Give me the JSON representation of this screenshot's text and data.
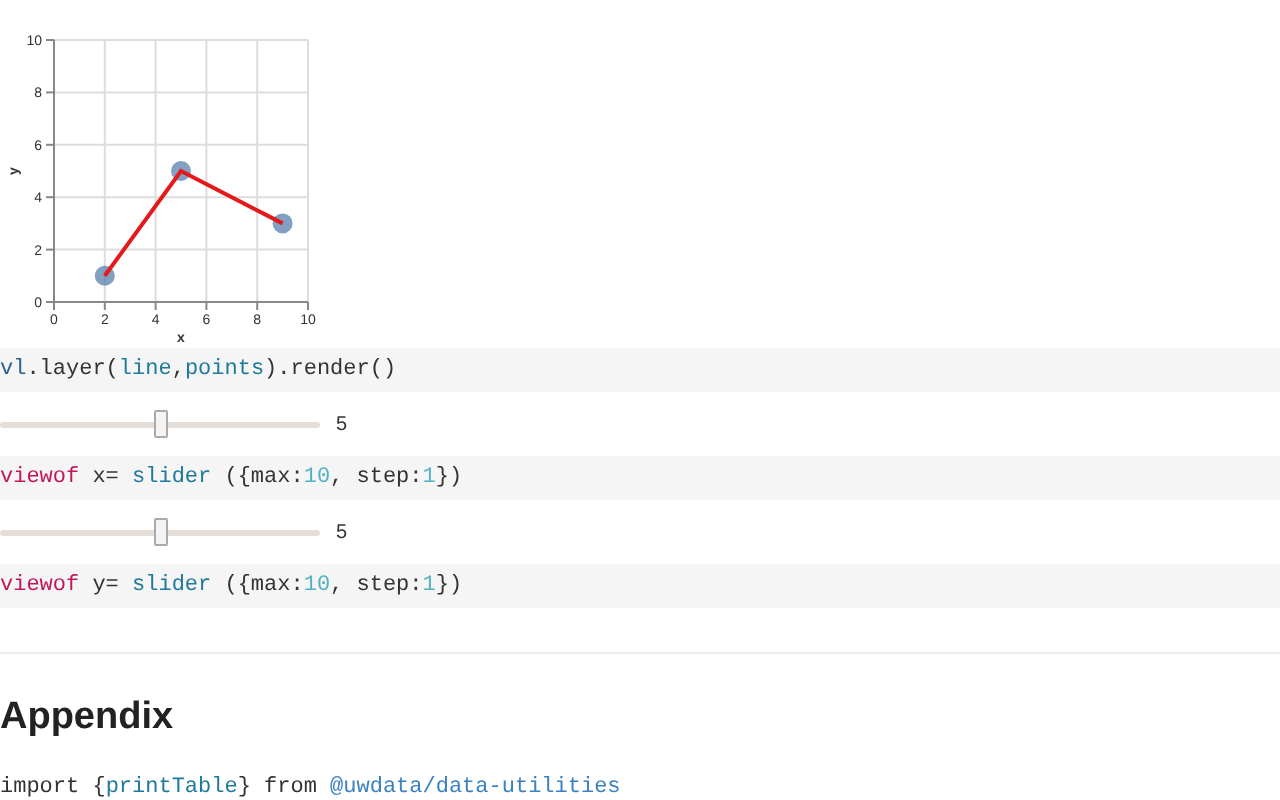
{
  "chart": {
    "chart_data": {
      "type": "line",
      "xlabel": "x",
      "ylabel": "y",
      "x": [
        2,
        5,
        9
      ],
      "xlim": [
        0,
        10
      ],
      "ylim": [
        0,
        10
      ],
      "xticks": [
        0,
        2,
        4,
        6,
        8,
        10
      ],
      "yticks": [
        0,
        2,
        4,
        6,
        8,
        10
      ],
      "grid": true,
      "series": [
        {
          "color": "#e31a1c",
          "values": [
            1,
            5,
            3
          ],
          "marker": true
        }
      ]
    }
  },
  "cells": [
    {
      "kind": "code",
      "tokens": [
        {
          "kind": "variable",
          "text": "vl"
        },
        {
          "kind": "plain",
          "text": ".layer("
        },
        {
          "kind": "function",
          "text": "line"
        },
        {
          "kind": "plain",
          "text": ","
        },
        {
          "kind": "function",
          "text": "points"
        },
        {
          "kind": "plain",
          "text": ").render()"
        }
      ]
    },
    {
      "kind": "slider",
      "level": 0.5,
      "reading": "5"
    },
    {
      "kind": "code",
      "tokens": [
        {
          "kind": "keyword",
          "text": "viewof"
        },
        {
          "kind": "plain",
          "text": " x= "
        },
        {
          "kind": "function",
          "text": "slider"
        },
        {
          "kind": "plain",
          "text": " ({max:"
        },
        {
          "kind": "number",
          "text": "10"
        },
        {
          "kind": "plain",
          "text": ", step:"
        },
        {
          "kind": "number",
          "text": "1"
        },
        {
          "kind": "plain",
          "text": "})"
        }
      ]
    },
    {
      "kind": "slider",
      "level": 0.5,
      "reading": "5"
    },
    {
      "kind": "code",
      "tokens": [
        {
          "kind": "keyword",
          "text": "viewof"
        },
        {
          "kind": "plain",
          "text": " y= "
        },
        {
          "kind": "function",
          "text": "slider"
        },
        {
          "kind": "plain",
          "text": " ({max:"
        },
        {
          "kind": "number",
          "text": "10"
        },
        {
          "kind": "plain",
          "text": ", step:"
        },
        {
          "kind": "number",
          "text": "1"
        },
        {
          "kind": "plain",
          "text": "})"
        }
      ]
    }
  ],
  "heading": "Appendix",
  "import_line": {
    "tokens": [
      {
        "kind": "plain",
        "text": "import {"
      },
      {
        "kind": "function",
        "text": "printTable"
      },
      {
        "kind": "plain",
        "text": "} from "
      },
      {
        "kind": "link",
        "text": "@uwdata/data-utilities"
      }
    ]
  }
}
